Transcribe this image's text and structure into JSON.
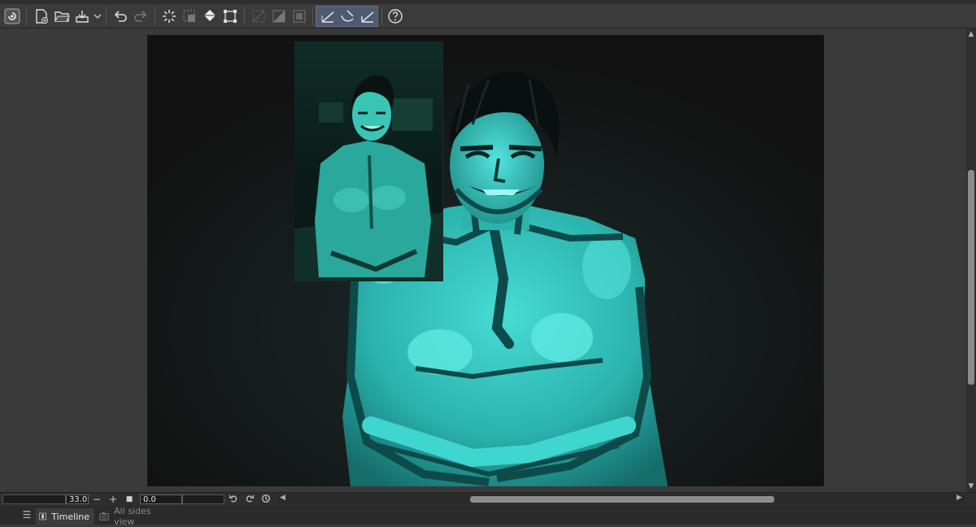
{
  "toolbar": {
    "buttons": [
      {
        "name": "clip-studio-icon"
      },
      {
        "name": "new-document-icon"
      },
      {
        "name": "open-folder-icon"
      },
      {
        "name": "save-icon"
      },
      {
        "name": "dropdown-chevron-icon"
      },
      {
        "name": "undo-icon"
      },
      {
        "name": "redo-icon"
      },
      {
        "name": "loading-spinner-icon"
      },
      {
        "name": "selection-icon"
      },
      {
        "name": "fill-icon"
      },
      {
        "name": "transform-icon"
      },
      {
        "name": "hide-selection-icon"
      },
      {
        "name": "fill-selection-icon"
      },
      {
        "name": "clear-selection-icon"
      },
      {
        "name": "snap-ruler-icon"
      },
      {
        "name": "snap-special-ruler-icon"
      },
      {
        "name": "snap-grid-icon"
      },
      {
        "name": "help-icon"
      }
    ]
  },
  "navigator": {
    "zoom": "33.0",
    "zoom_out": "−",
    "zoom_in": "+",
    "fit": "■",
    "angle": "0.0"
  },
  "tabs": {
    "timeline": "Timeline",
    "all_sides_view": "All sides view"
  },
  "colors": {
    "skin_cyan": "#3fd6cf",
    "skin_shadow": "#0d4a4a",
    "canvas_bg": "#121212",
    "ui_bg": "#3a3a3a"
  }
}
